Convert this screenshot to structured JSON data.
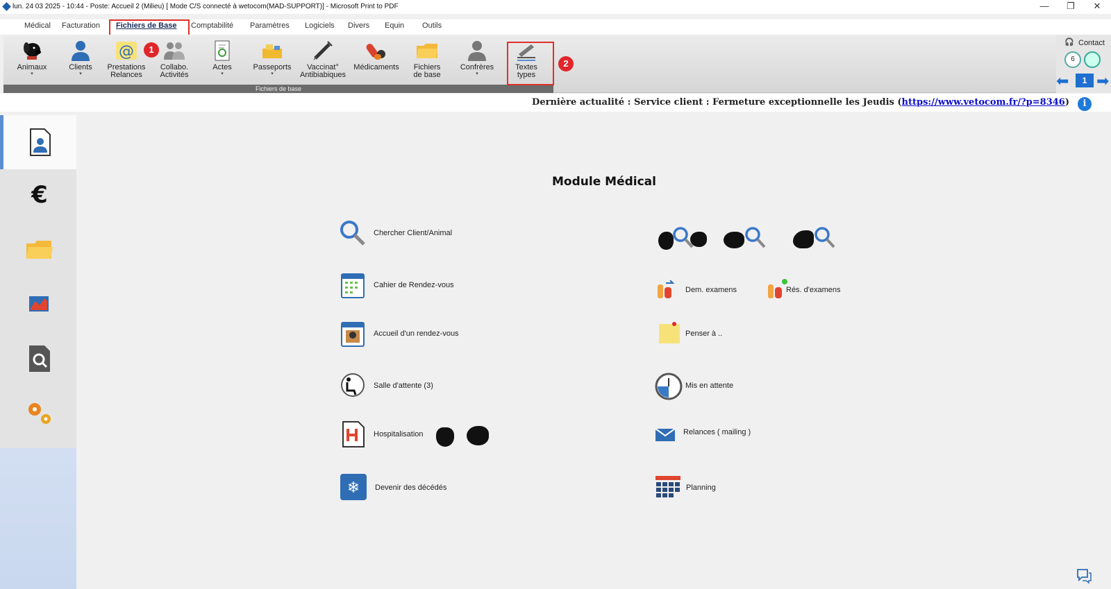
{
  "window": {
    "title": "lun. 24 03 2025 - 10:44 - Poste: Accueil 2 (Milieu)  [ Mode C/S connecté à wetocom(MAD-SUPPORT)] - Microsoft Print to PDF",
    "minimize": "—",
    "restore": "❐",
    "close": "✕"
  },
  "menu": {
    "tabs": [
      {
        "label": "Médical"
      },
      {
        "label": "Facturation"
      },
      {
        "label": "Fichiers de Base"
      },
      {
        "label": "Comptabilité"
      },
      {
        "label": "Paramètres"
      },
      {
        "label": "Logiciels"
      },
      {
        "label": "Divers"
      },
      {
        "label": "Equin"
      },
      {
        "label": "Outils"
      }
    ],
    "active_tab": "Fichiers de Base"
  },
  "ribbon": {
    "group_label": "Fichiers de base",
    "buttons": [
      {
        "line1": "Animaux",
        "line2": ""
      },
      {
        "line1": "Clients",
        "line2": ""
      },
      {
        "line1": "Prestations",
        "line2": "Relances"
      },
      {
        "line1": "Collabo.",
        "line2": "Activités"
      },
      {
        "line1": "Actes",
        "line2": ""
      },
      {
        "line1": "Passeports",
        "line2": ""
      },
      {
        "line1": "Vaccinat°",
        "line2": "Antibiabiques"
      },
      {
        "line1": "Médicaments",
        "line2": ""
      },
      {
        "line1": "Fichiers",
        "line2": "de base"
      },
      {
        "line1": "Confrères",
        "line2": ""
      },
      {
        "line1": "Textes",
        "line2": "types"
      }
    ],
    "contact_label": "Contact",
    "contact_count": "6",
    "nav_page": "1",
    "annotation_badges": [
      "1",
      "2"
    ]
  },
  "news": {
    "text": "Dernière actualité : Service client : Fermeture exceptionnelle les Jeudis (",
    "link": "https://www.vetocom.fr/?p=8346",
    "suffix": ")",
    "info_icon": "i"
  },
  "main": {
    "title": "Module Médical",
    "left_entries": [
      {
        "label": "Chercher Client/Animal",
        "icon": "search-icon"
      },
      {
        "label": "Cahier de Rendez-vous",
        "icon": "calendar-icon"
      },
      {
        "label": "Accueil d'un rendez-vous",
        "icon": "appointment-icon"
      },
      {
        "label": "Salle d'attente  (3)",
        "icon": "waiting-room-icon"
      },
      {
        "label": "Hospitalisation",
        "icon": "hospital-icon"
      },
      {
        "label": "Devenir des décédés",
        "icon": "snowflake-icon"
      }
    ],
    "right_entries": [
      {
        "label": "Dem. examens",
        "icon": "exam-request-icon"
      },
      {
        "label": "Rés. d'examens",
        "icon": "exam-result-icon"
      },
      {
        "label": "Penser à ..",
        "icon": "sticky-note-icon"
      },
      {
        "label": "Mis en attente",
        "icon": "clock-icon"
      },
      {
        "label": "Relances ( mailing )",
        "icon": "mail-icon"
      },
      {
        "label": "Planning",
        "icon": "planning-icon"
      }
    ]
  },
  "colors": {
    "accent": "#5b8fcf",
    "annotation_red": "#e0262a",
    "search_blue": "#3a78c8",
    "folder_yellow": "#f4c430"
  }
}
